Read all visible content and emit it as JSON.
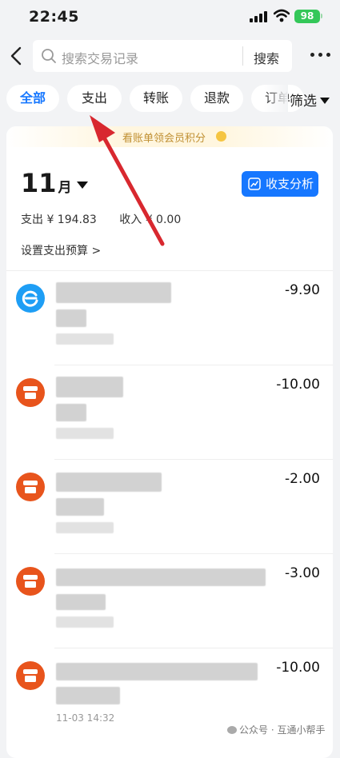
{
  "status_bar": {
    "time": "22:45",
    "battery": "98"
  },
  "search": {
    "placeholder": "搜索交易记录",
    "button_label": "搜索"
  },
  "tabs": [
    {
      "label": "全部",
      "active": true
    },
    {
      "label": "支出",
      "active": false
    },
    {
      "label": "转账",
      "active": false
    },
    {
      "label": "退款",
      "active": false
    },
    {
      "label": "订单",
      "active": false
    }
  ],
  "filter_label": "筛选",
  "promo_text": "看账单领会员积分",
  "month": {
    "number": "11",
    "unit": "月"
  },
  "analysis_button": "收支分析",
  "summary": {
    "expense": "支出 ¥ 194.83",
    "income": "收入 ¥ 0.00"
  },
  "budget_link": "设置支出预算 >",
  "transactions": [
    {
      "icon": "circle-e-icon",
      "color": "#1e9ef5",
      "amount": "-9.90"
    },
    {
      "icon": "store-icon",
      "color": "#e8541c",
      "amount": "-10.00"
    },
    {
      "icon": "store-icon",
      "color": "#e8541c",
      "amount": "-2.00"
    },
    {
      "icon": "store-icon",
      "color": "#e8541c",
      "amount": "-3.00"
    },
    {
      "icon": "store-icon",
      "color": "#e8541c",
      "amount": "-10.00",
      "date": "11-03 14:32"
    }
  ],
  "watermark": "公众号 · 互通小帮手",
  "colors": {
    "accent": "#1677ff",
    "annotation_arrow": "#d8282f",
    "store": "#e8541c",
    "brand_e": "#1e9ef5"
  }
}
